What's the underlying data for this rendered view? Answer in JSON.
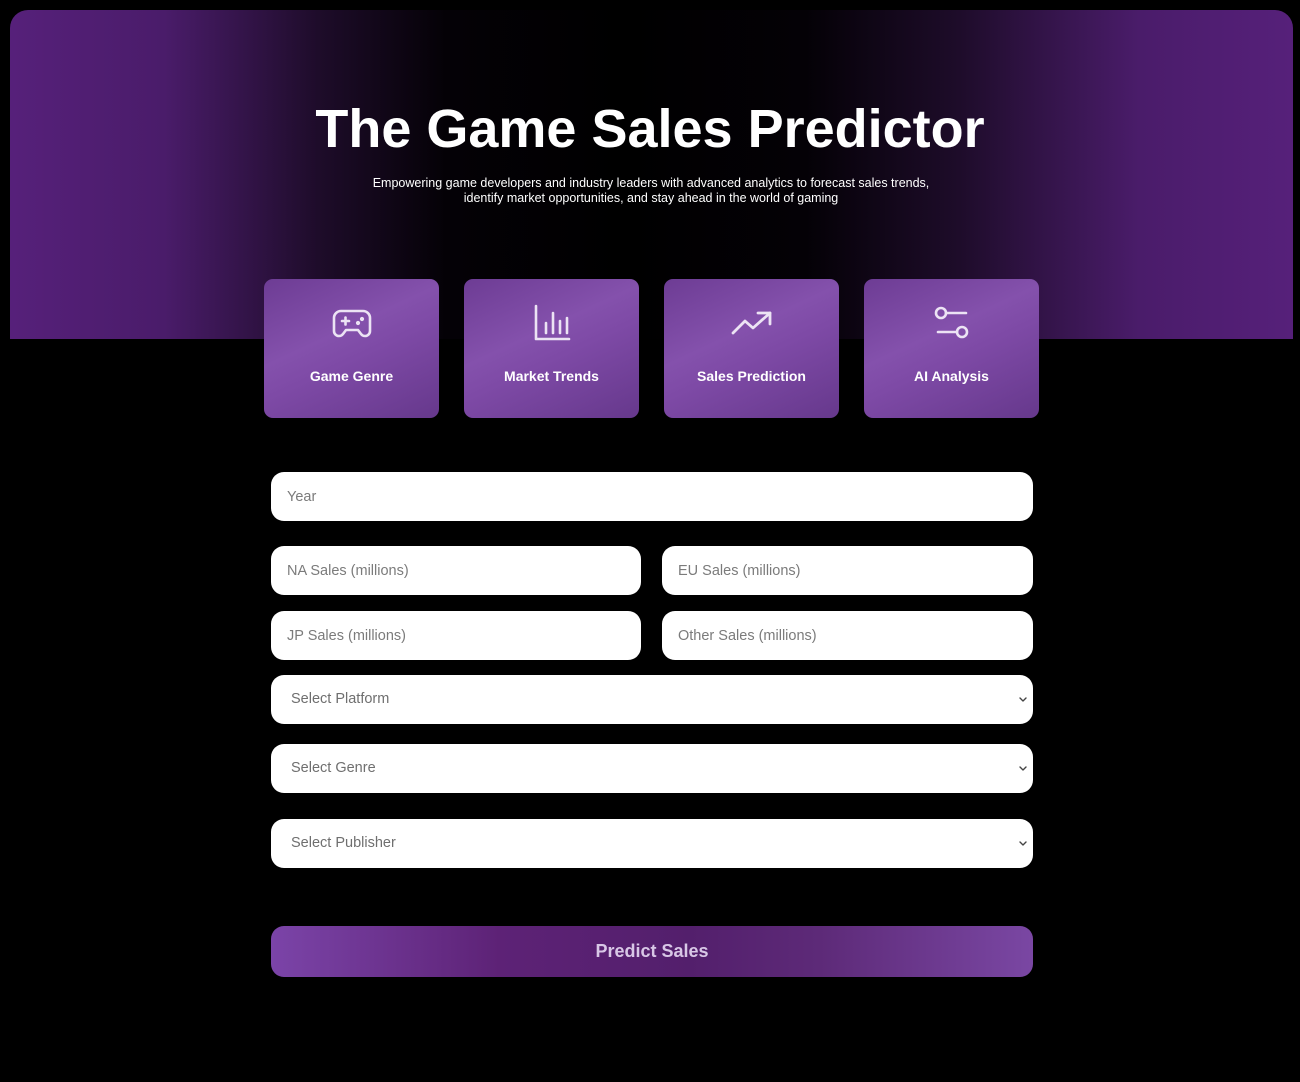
{
  "hero": {
    "title": "The Game Sales Predictor",
    "subtitle": "Empowering game developers and industry leaders with advanced analytics to forecast sales trends, identify market opportunities, and stay ahead in the world of gaming"
  },
  "features": [
    {
      "label": "Game Genre",
      "icon": "gamepad-icon"
    },
    {
      "label": "Market Trends",
      "icon": "bar-chart-icon"
    },
    {
      "label": "Sales Prediction",
      "icon": "trending-up-icon"
    },
    {
      "label": "AI Analysis",
      "icon": "sliders-icon"
    }
  ],
  "form": {
    "year_placeholder": "Year",
    "na_sales_placeholder": "NA Sales (millions)",
    "eu_sales_placeholder": "EU Sales (millions)",
    "jp_sales_placeholder": "JP Sales (millions)",
    "other_sales_placeholder": "Other Sales (millions)",
    "platform_select": "Select Platform",
    "genre_select": "Select Genre",
    "publisher_select": "Select Publisher",
    "submit_label": "Predict Sales"
  },
  "colors": {
    "accent": "#7b44a8",
    "background": "#000000",
    "card": "#8451ac"
  }
}
